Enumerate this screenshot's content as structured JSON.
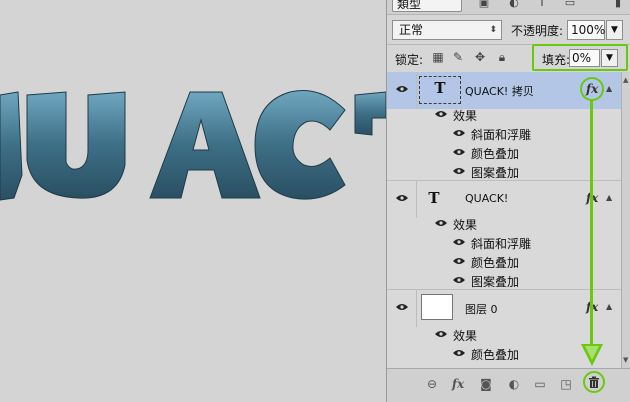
{
  "canvas": {
    "text": "QUACK!"
  },
  "filter": {
    "kind_label": "類型",
    "icons": [
      "image-filter-icon",
      "adjustment-filter-icon",
      "type-filter-icon",
      "shape-filter-icon",
      "toggle-filter-icon"
    ]
  },
  "blend": {
    "mode": "正常"
  },
  "opacity": {
    "label": "不透明度:",
    "value": "100%"
  },
  "lock": {
    "label": "锁定:"
  },
  "fill": {
    "label": "填充:",
    "value": "0%"
  },
  "layers": [
    {
      "name": "QUACK! 拷贝",
      "type": "text",
      "thumb": "T",
      "selected": true,
      "fx": "fx",
      "effects_label": "效果",
      "effects": [
        "斜面和浮雕",
        "颜色叠加",
        "图案叠加"
      ]
    },
    {
      "name": "QUACK!",
      "type": "text",
      "thumb": "T",
      "selected": false,
      "fx": "fx",
      "effects_label": "效果",
      "effects": [
        "斜面和浮雕",
        "颜色叠加",
        "图案叠加"
      ]
    },
    {
      "name": "图层 0",
      "type": "raster",
      "thumb": "",
      "selected": false,
      "fx": "fx",
      "effects_label": "效果",
      "effects": [
        "颜色叠加"
      ]
    }
  ],
  "bottom_icons": [
    "link-icon",
    "fx-icon",
    "mask-icon",
    "adjustment-icon",
    "group-folder-icon",
    "new-layer-icon",
    "trash-icon"
  ],
  "colors": {
    "highlight": "#6ac90e",
    "selected_layer": "#b3c6e6",
    "text_steel": "#3d6f86"
  }
}
